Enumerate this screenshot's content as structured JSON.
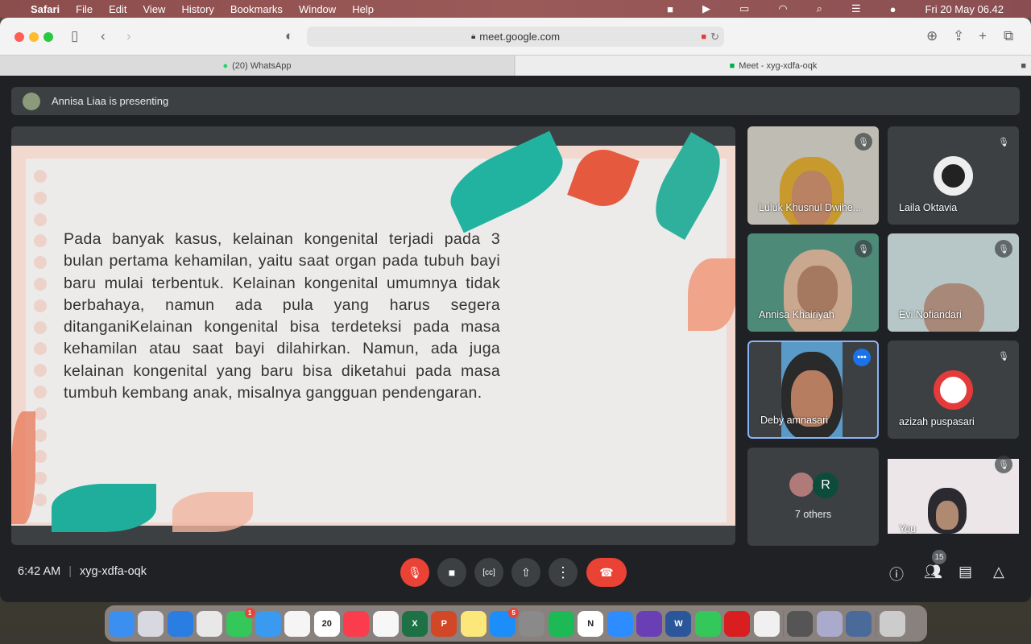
{
  "menubar": {
    "items": [
      "Safari",
      "File",
      "Edit",
      "View",
      "History",
      "Bookmarks",
      "Window",
      "Help"
    ],
    "clock": "Fri 20 May  06.42"
  },
  "browser": {
    "url": "meet.google.com",
    "tabs": [
      {
        "label": "(20) WhatsApp",
        "active": false
      },
      {
        "label": "Meet - xyg-xdfa-oqk",
        "active": true
      }
    ]
  },
  "meet": {
    "presenting": "Annisa Liaa is presenting",
    "slide_text": "Pada banyak kasus, kelainan kongenital terjadi pada 3 bulan pertama kehamilan, yaitu saat organ pada tubuh bayi baru mulai terbentuk. Kelainan kongenital umumnya tidak berbahaya, namun ada pula yang harus segera ditanganiKelainan kongenital bisa terdeteksi pada masa kehamilan atau saat bayi dilahirkan. Namun, ada juga kelainan kongenital yang baru bisa diketahui pada masa tumbuh kembang anak, misalnya gangguan pendengaran.",
    "participants": [
      {
        "name": "Luluk Khusnul Dwihe...",
        "muted": true,
        "video": true
      },
      {
        "name": "Laila Oktavia",
        "muted": true,
        "video": false
      },
      {
        "name": "Annisa Khairiyah",
        "muted": true,
        "video": true
      },
      {
        "name": "Evi Nofiandari",
        "muted": true,
        "video": true
      },
      {
        "name": "Deby amnasari",
        "muted": false,
        "video": true,
        "active_speaker": true
      },
      {
        "name": "azizah puspasari",
        "muted": true,
        "video": false
      },
      {
        "others": "7 others",
        "avatar_letter": "R"
      },
      {
        "name": "You",
        "muted": true,
        "video": true
      }
    ],
    "time": "6:42 AM",
    "meeting_code": "xyg-xdfa-oqk",
    "participant_count": "15",
    "colors": {
      "end_call": "#ea4335",
      "mic_off": "#ea4335",
      "active_border": "#8ab4f8",
      "bg": "#202124"
    }
  },
  "dock": {
    "apps": [
      {
        "name": "Finder",
        "color": "#3b8ff0"
      },
      {
        "name": "Launchpad",
        "color": "#d8d8e0"
      },
      {
        "name": "Safari",
        "color": "#2a7de1"
      },
      {
        "name": "Chrome",
        "color": "#e8e8e8"
      },
      {
        "name": "Messages",
        "color": "#34c759",
        "badge": "1"
      },
      {
        "name": "Mail",
        "color": "#3a9af0"
      },
      {
        "name": "Photos",
        "color": "#f5f5f5"
      },
      {
        "name": "Calendar",
        "color": "#fff",
        "label": "20"
      },
      {
        "name": "Music",
        "color": "#fa3c4c"
      },
      {
        "name": "Pages",
        "color": "#f7f7f7"
      },
      {
        "name": "Excel",
        "color": "#1e7145",
        "label": "X"
      },
      {
        "name": "PowerPoint",
        "color": "#d24726",
        "label": "P"
      },
      {
        "name": "Notes",
        "color": "#fbe77a"
      },
      {
        "name": "App Store",
        "color": "#1c8ef9",
        "badge": "5"
      },
      {
        "name": "System Preferences",
        "color": "#8a8a8a"
      },
      {
        "name": "Spotify",
        "color": "#1db954"
      },
      {
        "name": "Notion",
        "color": "#fff",
        "label": "N"
      },
      {
        "name": "Zoom",
        "color": "#2d8cff"
      },
      {
        "name": "iMovie",
        "color": "#6a3fb5"
      },
      {
        "name": "Word",
        "color": "#2b579a",
        "label": "W"
      },
      {
        "name": "FaceTime",
        "color": "#34c759"
      },
      {
        "name": "Photo Booth",
        "color": "#d81e1e"
      },
      {
        "name": "Keynote",
        "color": "#f0f0f0"
      }
    ],
    "utilities": [
      {
        "name": "Calculator",
        "color": "#555"
      },
      {
        "name": "Preview",
        "color": "#aac"
      },
      {
        "name": "QuickTime",
        "color": "#4a6a9a"
      }
    ],
    "trash": "Trash"
  }
}
